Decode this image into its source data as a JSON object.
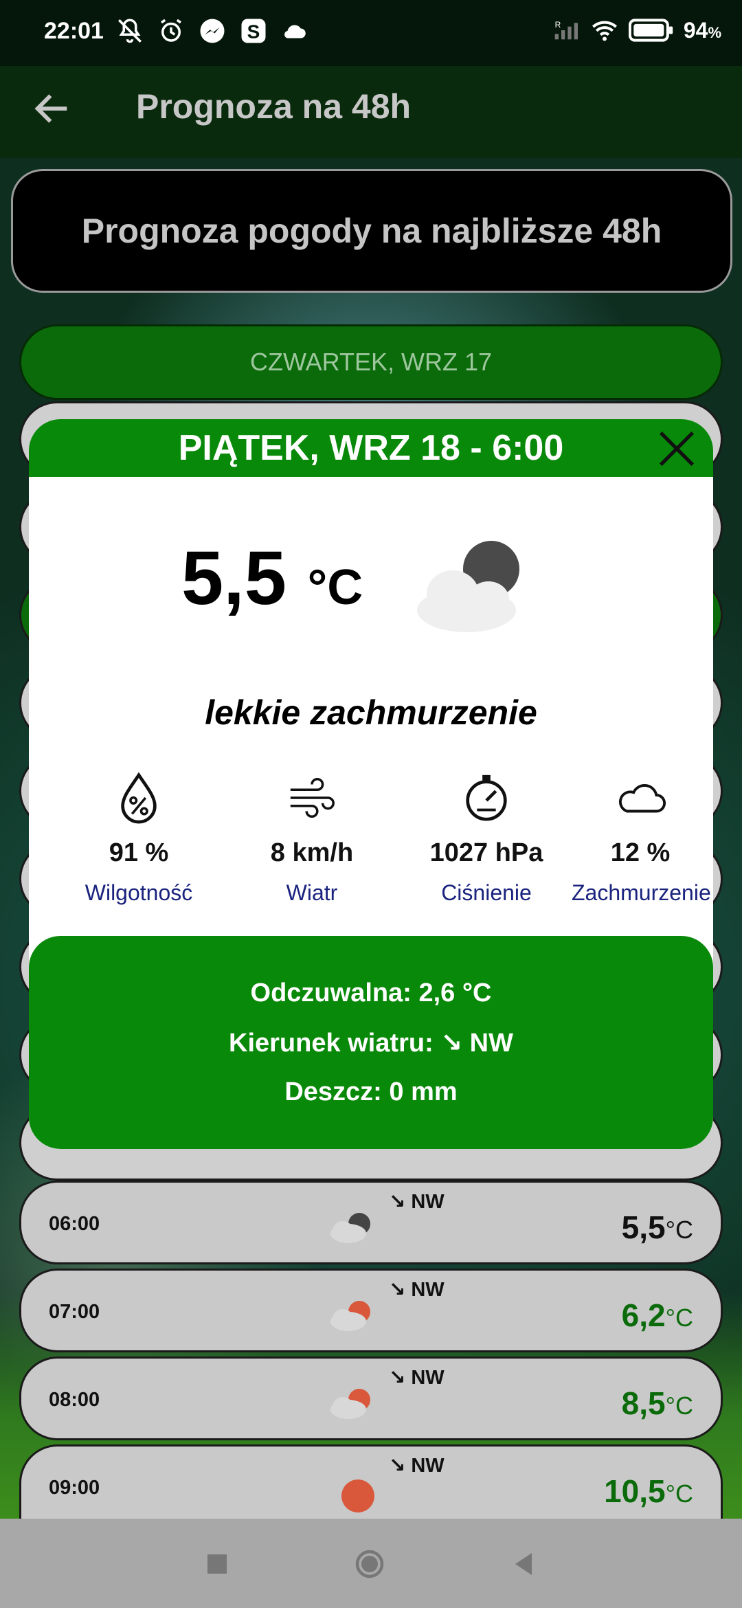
{
  "status_bar": {
    "time": "22:01",
    "battery": "94",
    "battery_unit": "%"
  },
  "app_bar": {
    "title": "Prognoza na 48h"
  },
  "banner": {
    "text": "Prognoza pogody na najbliższe 48h"
  },
  "day_header": {
    "label": "CZWARTEK, WRZ 17"
  },
  "popup": {
    "title": "PIĄTEK, WRZ 18 - 6:00",
    "temperature": "5,5",
    "temperature_unit": "°C",
    "condition": "lekkie zachmurzenie",
    "icon": "partly-cloudy-night-icon",
    "stats": [
      {
        "icon": "humidity-icon",
        "value": "91 %",
        "label": "Wilgotność"
      },
      {
        "icon": "wind-icon",
        "value": "8 km/h",
        "label": "Wiatr"
      },
      {
        "icon": "pressure-icon",
        "value": "1027 hPa",
        "label": "Ciśnienie"
      },
      {
        "icon": "cloud-icon",
        "value": "12 %",
        "label": "Zachmurzenie"
      }
    ],
    "details": {
      "feels_like": "Odczuwalna: 2,6 °C",
      "wind_direction": "Kierunek wiatru: ↘ NW",
      "rain": "Deszcz: 0 mm"
    }
  },
  "hourly": [
    {
      "time": "06:00",
      "wind": "↘ NW",
      "temp": "5,5",
      "unit": "°C",
      "icon": "partly-cloudy-night-icon",
      "temp_color": "#111111"
    },
    {
      "time": "07:00",
      "wind": "↘ NW",
      "temp": "6,2",
      "unit": "°C",
      "icon": "partly-cloudy-day-icon",
      "temp_color": "#0b6b0b"
    },
    {
      "time": "08:00",
      "wind": "↘ NW",
      "temp": "8,5",
      "unit": "°C",
      "icon": "partly-cloudy-day-icon",
      "temp_color": "#0b6b0b"
    },
    {
      "time": "09:00",
      "wind": "↘ NW",
      "temp": "10,5",
      "unit": "°C",
      "icon": "sun-icon",
      "temp_color": "#0b6b0b"
    }
  ],
  "colors": {
    "accent_green": "#098909",
    "label_blue": "#1a237e"
  }
}
